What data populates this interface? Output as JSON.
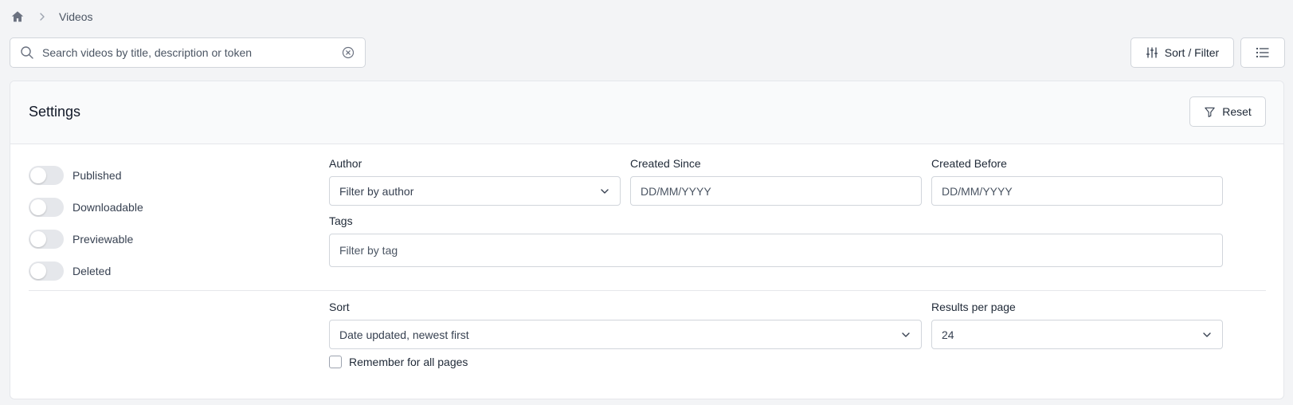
{
  "breadcrumb": {
    "home_icon": "home-icon",
    "separator_icon": "chevron-right-icon",
    "current": "Videos"
  },
  "search": {
    "placeholder": "Search videos by title, description or token",
    "value": ""
  },
  "toolbar": {
    "sort_filter_label": "Sort / Filter",
    "sort_filter_icon": "sliders-icon",
    "list_icon": "list-icon"
  },
  "settings": {
    "title": "Settings",
    "reset_label": "Reset",
    "reset_icon": "filter-icon",
    "toggles": [
      {
        "label": "Published",
        "on": false
      },
      {
        "label": "Downloadable",
        "on": false
      },
      {
        "label": "Previewable",
        "on": false
      },
      {
        "label": "Deleted",
        "on": false
      }
    ],
    "author": {
      "label": "Author",
      "value": "Filter by author"
    },
    "created_since": {
      "label": "Created Since",
      "placeholder": "DD/MM/YYYY"
    },
    "created_before": {
      "label": "Created Before",
      "placeholder": "DD/MM/YYYY"
    },
    "tags": {
      "label": "Tags",
      "placeholder": "Filter by tag"
    },
    "sort": {
      "label": "Sort",
      "value": "Date updated, newest first"
    },
    "results_per_page": {
      "label": "Results per page",
      "value": "24"
    },
    "remember_label": "Remember for all pages",
    "remember_checked": false
  },
  "colors": {
    "background": "#f3f4f6",
    "border": "#d1d5db",
    "toggle_off": "#e5e7eb"
  }
}
